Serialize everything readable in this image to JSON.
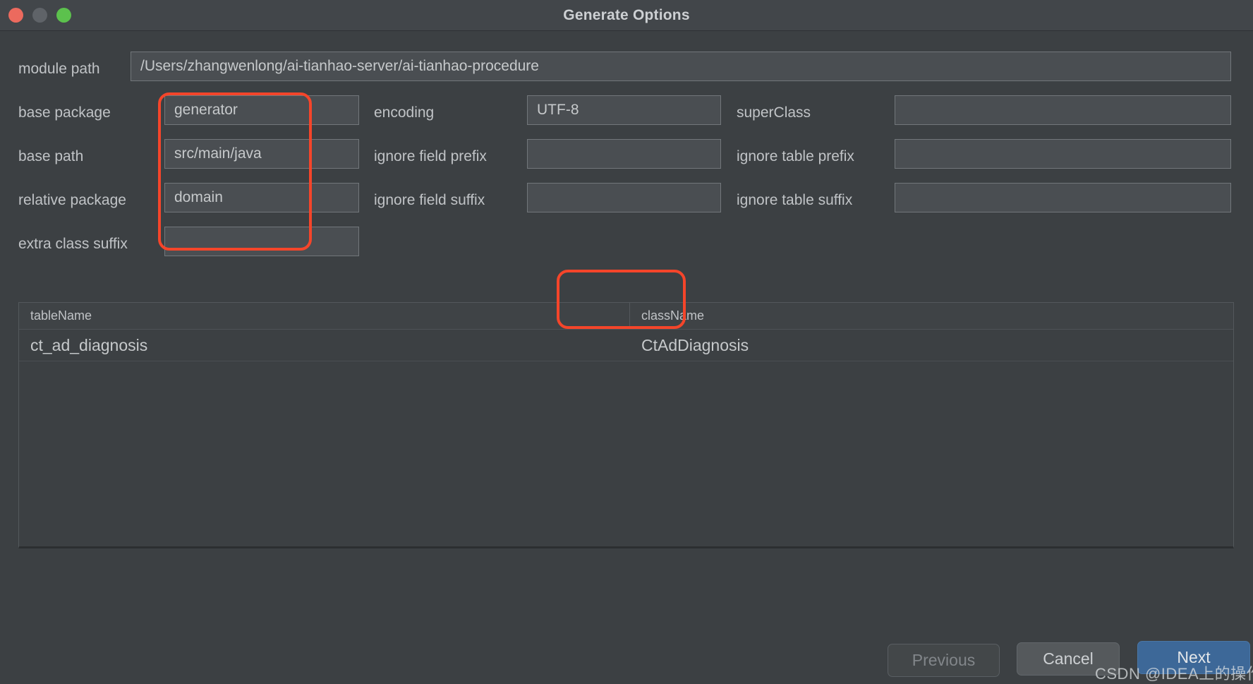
{
  "window": {
    "title": "Generate Options",
    "traffic_lights": [
      {
        "name": "close-button",
        "color": "#ec6a5e"
      },
      {
        "name": "minimize-button",
        "color": "#5f6368"
      },
      {
        "name": "maximize-button",
        "color": "#5cc14d"
      }
    ]
  },
  "form": {
    "module_path": {
      "label": "module path",
      "value": "/Users/zhangwenlong/ai-tianhao-server/ai-tianhao-procedure",
      "placeholder": ""
    },
    "base_package": {
      "label": "base package",
      "value": "generator",
      "placeholder": ""
    },
    "encoding": {
      "label": "encoding",
      "value": "UTF-8",
      "placeholder": ""
    },
    "super_class": {
      "label": "superClass",
      "value": "",
      "placeholder": ""
    },
    "base_path": {
      "label": "base path",
      "value": "src/main/java",
      "placeholder": ""
    },
    "ignore_field_prefix": {
      "label": "ignore field prefix",
      "value": "",
      "placeholder": ""
    },
    "ignore_table_prefix": {
      "label": "ignore table prefix",
      "value": "",
      "placeholder": ""
    },
    "relative_package": {
      "label": "relative package",
      "value": "domain",
      "placeholder": ""
    },
    "ignore_field_suffix": {
      "label": "ignore field suffix",
      "value": "",
      "placeholder": ""
    },
    "ignore_table_suffix": {
      "label": "ignore table suffix",
      "value": "",
      "placeholder": ""
    },
    "extra_class_suffix": {
      "label": "extra class suffix",
      "value": "",
      "placeholder": ""
    }
  },
  "table": {
    "columns": [
      "tableName",
      "className"
    ],
    "rows": [
      {
        "tableName": "ct_ad_diagnosis",
        "className": "CtAdDiagnosis"
      }
    ]
  },
  "footer": {
    "previous_label": "Previous",
    "cancel_label": "Cancel",
    "next_label": "Next"
  },
  "annotations": {
    "accent_color": "#f5452a",
    "left_fields_highlight": "base package / base path / relative package value inputs",
    "classname_highlight": "className column header and CtAdDiagnosis cell"
  },
  "watermark": {
    "text": "CSDN @IDEA上的操作工"
  }
}
